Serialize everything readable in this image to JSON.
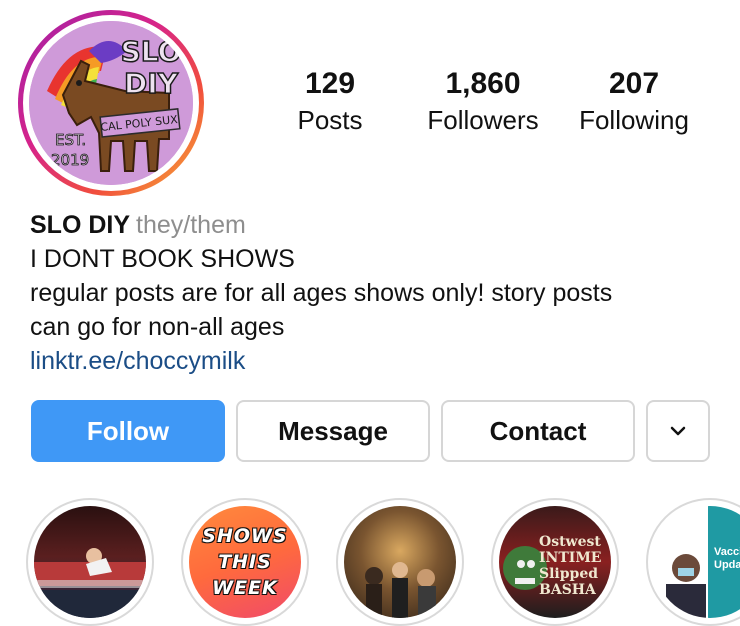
{
  "profile": {
    "avatar": {
      "line1": "SLO",
      "line2": "DIY",
      "banner": "CAL POLY SUX",
      "est": "EST.",
      "year": "2019"
    },
    "stats": {
      "posts": {
        "value": "129",
        "label": "Posts"
      },
      "followers": {
        "value": "1,860",
        "label": "Followers"
      },
      "following": {
        "value": "207",
        "label": "Following"
      }
    },
    "name": "SLO DIY",
    "pronouns": "they/them",
    "bio": [
      "I DONT BOOK SHOWS",
      "regular posts are for all ages shows only! story posts",
      "can go for non-all ages"
    ],
    "link": "linktr.ee/choccymilk"
  },
  "actions": {
    "follow": "Follow",
    "message": "Message",
    "contact": "Contact",
    "more_icon": "chevron-down-icon"
  },
  "highlights": [
    {
      "id": "hl-1"
    },
    {
      "id": "hl-2",
      "text": [
        "SHOWS",
        "THIS",
        "WEEK"
      ]
    },
    {
      "id": "hl-3"
    },
    {
      "id": "hl-4",
      "text": [
        "Ostwest",
        "INTIME",
        "Slipped",
        "BASHA"
      ]
    },
    {
      "id": "hl-5",
      "text": [
        "Vaccine",
        "Update"
      ]
    }
  ],
  "colors": {
    "follow_button": "#3f98f6",
    "link": "#1b4d86",
    "pronouns": "#8e8e8e",
    "story_ring_start": "#a020a8",
    "story_ring_end": "#f7b634"
  }
}
